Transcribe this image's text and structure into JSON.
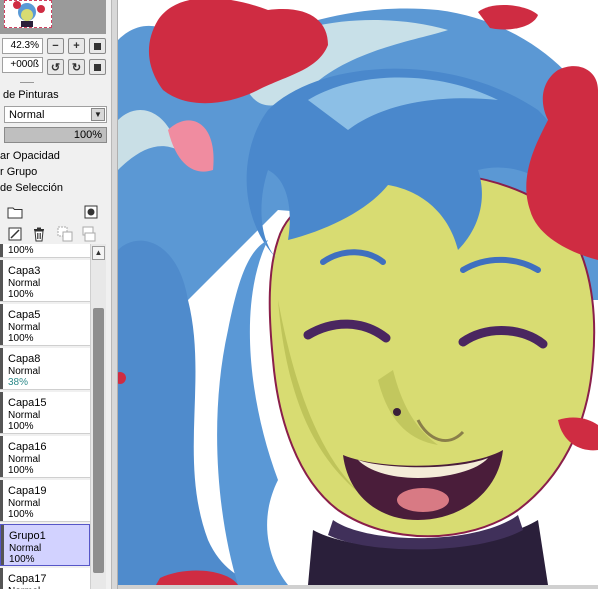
{
  "navigator": {
    "zoom": "42.3%",
    "rotation": "+000ß"
  },
  "layer_props": {
    "paint_mode_label": "de Pinturas",
    "blend_mode": "Normal",
    "opacity": "100%",
    "opacity_fraction": 1.0,
    "options": [
      "ar Opacidad",
      "r Grupo",
      "de Selección"
    ]
  },
  "layers": {
    "top_partial_opacity": "100%",
    "items": [
      {
        "name": "Capa3",
        "mode": "Normal",
        "opacity": "100%"
      },
      {
        "name": "Capa5",
        "mode": "Normal",
        "opacity": "100%"
      },
      {
        "name": "Capa8",
        "mode": "Normal",
        "opacity": "38%"
      },
      {
        "name": "Capa15",
        "mode": "Normal",
        "opacity": "100%"
      },
      {
        "name": "Capa16",
        "mode": "Normal",
        "opacity": "100%"
      },
      {
        "name": "Capa19",
        "mode": "Normal",
        "opacity": "100%"
      },
      {
        "name": "Grupo1",
        "mode": "Normal",
        "opacity": "100%"
      },
      {
        "name": "Capa17",
        "mode": "Normal",
        "opacity": "100%"
      }
    ],
    "selected": "Grupo1"
  },
  "colors": {
    "panel_bg": "#f0f0f0",
    "selected_layer": "#d2d2ff",
    "low_opacity_text": "#2e8a8a",
    "hair": "#5a9ad6",
    "skin": "#d8dc72",
    "paint_red": "#cf2c42"
  },
  "icons": [
    "zoom-out-icon",
    "zoom-in-icon",
    "fit-icon",
    "rotate-left-icon",
    "rotate-right-icon",
    "reset-rotation-icon",
    "new-folder-icon",
    "record-icon",
    "clear-layer-icon",
    "delete-layer-icon",
    "transfer-down-icon",
    "merge-down-icon",
    "scroll-up-icon"
  ]
}
